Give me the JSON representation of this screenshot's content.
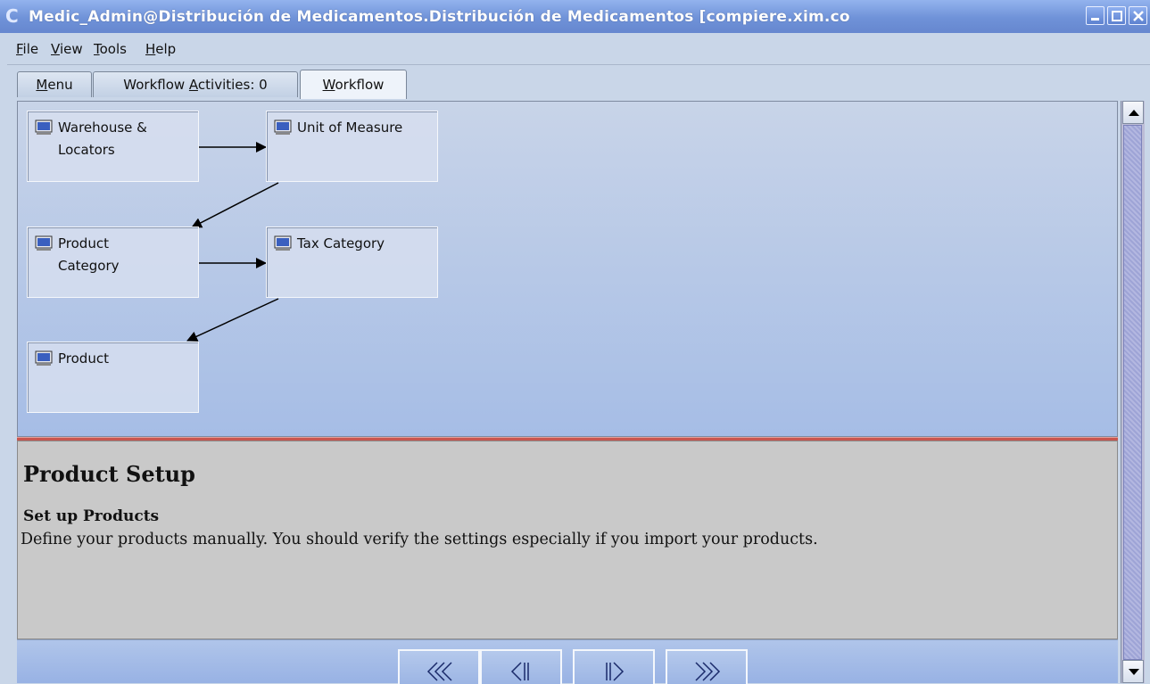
{
  "window": {
    "title": "Medic_Admin@Distribución de Medicamentos.Distribución de Medicamentos [compiere.xim.co",
    "buttons": [
      "minimize",
      "maximize",
      "close"
    ]
  },
  "menubar": {
    "items": [
      {
        "label": "File",
        "mnemonic": "F",
        "rest": "ile"
      },
      {
        "label": "View",
        "mnemonic": "V",
        "rest": "iew"
      },
      {
        "label": "Tools",
        "mnemonic": "T",
        "rest": "ools"
      },
      {
        "label": "Help",
        "mnemonic": "H",
        "rest": "elp"
      }
    ]
  },
  "tabs": [
    {
      "label": "Menu",
      "pre": "",
      "mnemonic": "M",
      "post": "enu",
      "active": false
    },
    {
      "label": "Workflow Activities: 0",
      "pre": "Workflow ",
      "mnemonic": "A",
      "post": "ctivities: 0",
      "active": false
    },
    {
      "label": "Workflow",
      "pre": "",
      "mnemonic": "W",
      "post": "orkflow",
      "active": true
    }
  ],
  "workflow": {
    "nodes": [
      {
        "id": "warehouse",
        "line1": "Warehouse &",
        "line2": "Locators",
        "icon": "monitor-icon"
      },
      {
        "id": "uom",
        "line1": "Unit of Measure",
        "line2": "",
        "icon": "monitor-icon"
      },
      {
        "id": "product-category",
        "line1": "Product",
        "line2": "Category",
        "icon": "monitor-icon"
      },
      {
        "id": "tax-category",
        "line1": "Tax Category",
        "line2": "",
        "icon": "monitor-icon"
      },
      {
        "id": "product",
        "line1": "Product",
        "line2": "",
        "icon": "monitor-icon"
      }
    ],
    "edges": [
      [
        "warehouse",
        "uom"
      ],
      [
        "uom",
        "product-category"
      ],
      [
        "product-category",
        "tax-category"
      ],
      [
        "tax-category",
        "product"
      ]
    ]
  },
  "description": {
    "title": "Product Setup",
    "subtitle": "Set up Products",
    "text": "Define your products manually. You should verify the settings especially if you import your products."
  },
  "navigation": {
    "buttons": [
      "first-icon",
      "previous-icon",
      "next-icon",
      "last-icon"
    ]
  },
  "colors": {
    "titlebar": "#6f92d8",
    "divider": "#c9564e",
    "workflow_bg": "#b5c8ea",
    "description_bg": "#c9c9c9"
  }
}
